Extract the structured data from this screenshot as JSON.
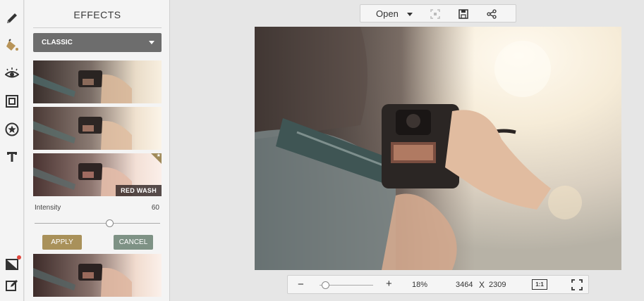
{
  "tools": [
    {
      "name": "pencil-icon"
    },
    {
      "name": "paint-bucket-icon"
    },
    {
      "name": "eye-icon"
    },
    {
      "name": "frame-icon"
    },
    {
      "name": "star-sticker-icon"
    },
    {
      "name": "text-icon"
    }
  ],
  "panel": {
    "title": "EFFECTS",
    "category": "CLASSIC",
    "selected_effect": "RED WASH",
    "intensity_label": "Intensity",
    "intensity_value": "60",
    "intensity_fraction": 0.6,
    "apply_label": "APPLY",
    "cancel_label": "CANCEL"
  },
  "topbar": {
    "open_label": "Open"
  },
  "bottombar": {
    "minus": "−",
    "plus": "+",
    "zoom": "18%",
    "width": "3464",
    "x": "X",
    "height": "2309",
    "ratio": "1:1"
  },
  "colors": {
    "accent": "#a9915a",
    "cancel": "#7e9285",
    "dropdown": "#6d6d6d",
    "notification": "#e0473d"
  }
}
